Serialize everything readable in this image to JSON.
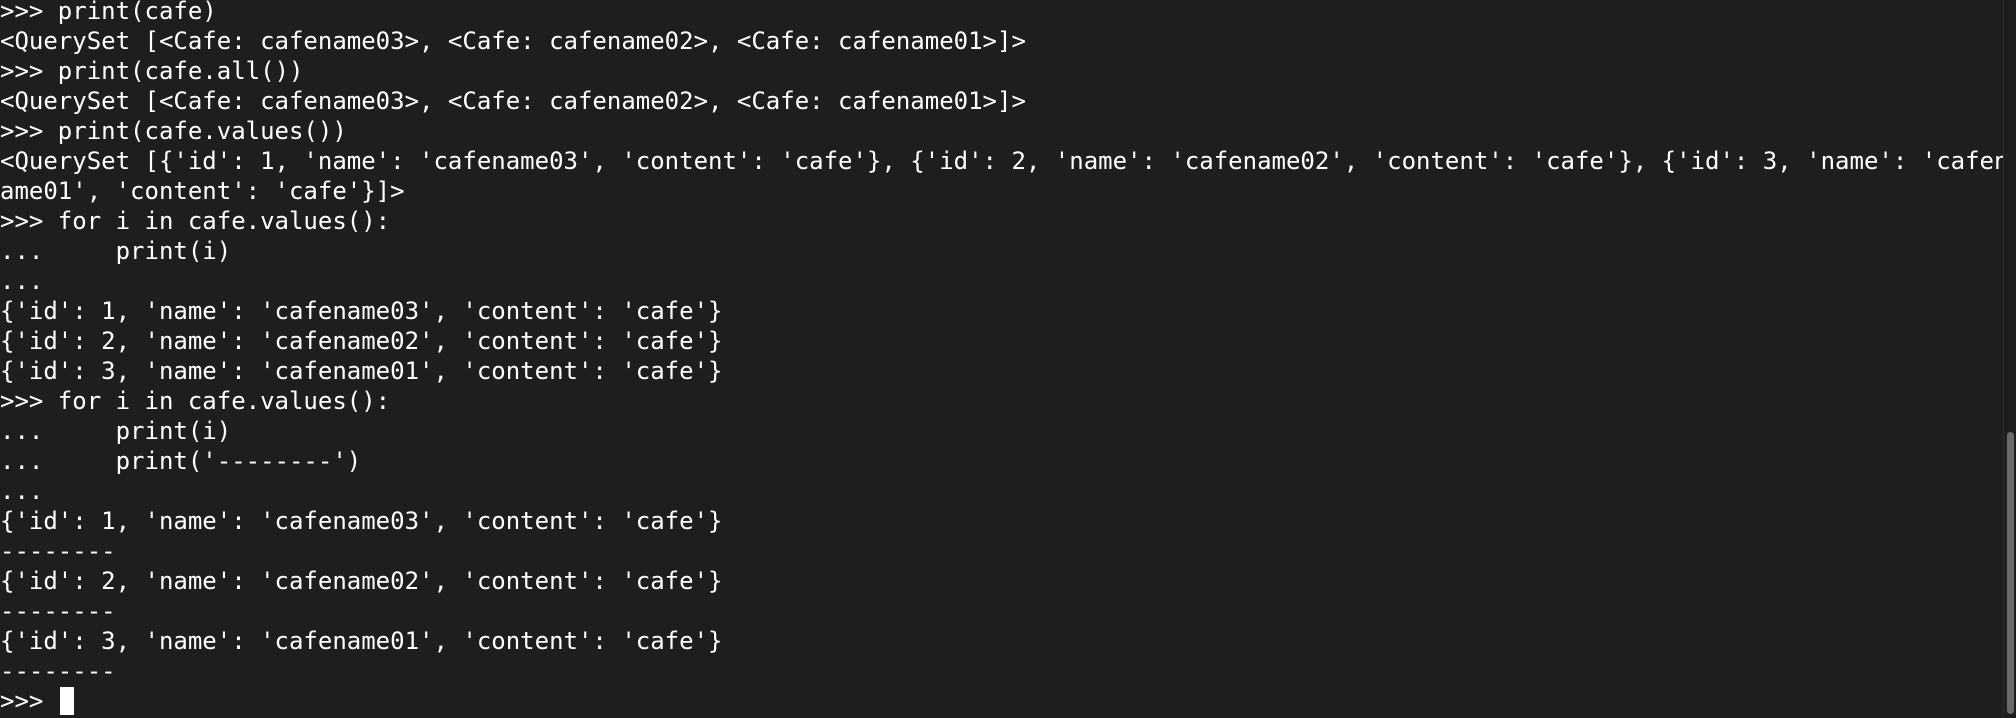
{
  "terminal": {
    "lines": [
      ">>> print(cafe)",
      "<QuerySet [<Cafe: cafename03>, <Cafe: cafename02>, <Cafe: cafename01>]>",
      ">>> print(cafe.all())",
      "<QuerySet [<Cafe: cafename03>, <Cafe: cafename02>, <Cafe: cafename01>]>",
      ">>> print(cafe.values())",
      "<QuerySet [{'id': 1, 'name': 'cafename03', 'content': 'cafe'}, {'id': 2, 'name': 'cafename02', 'content': 'cafe'}, {'id': 3, 'name': 'cafen",
      "ame01', 'content': 'cafe'}]>",
      ">>> for i in cafe.values():",
      "...     print(i)",
      "...",
      "{'id': 1, 'name': 'cafename03', 'content': 'cafe'}",
      "{'id': 2, 'name': 'cafename02', 'content': 'cafe'}",
      "{'id': 3, 'name': 'cafename01', 'content': 'cafe'}",
      ">>> for i in cafe.values():",
      "...     print(i)",
      "...     print('--------')",
      "...",
      "{'id': 1, 'name': 'cafename03', 'content': 'cafe'}",
      "--------",
      "{'id': 2, 'name': 'cafename02', 'content': 'cafe'}",
      "--------",
      "{'id': 3, 'name': 'cafename01', 'content': 'cafe'}",
      "--------"
    ],
    "prompt": ">>> ",
    "colors": {
      "background": "#1e1e1e",
      "text": "#ffffff",
      "scrollbar_thumb": "#6b6b6b"
    }
  }
}
